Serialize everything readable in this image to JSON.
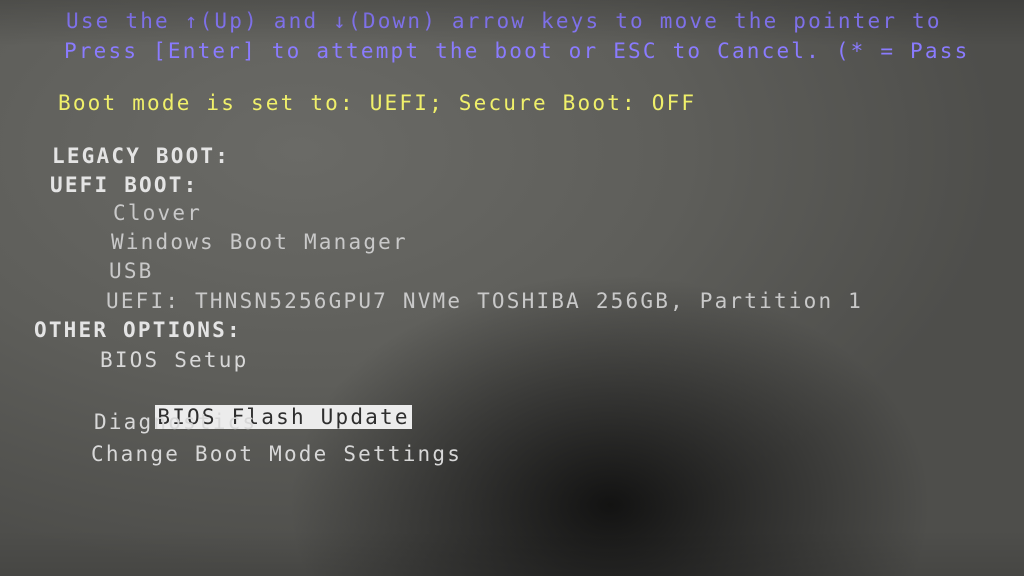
{
  "instructions": {
    "line1": "Use the ↑(Up) and ↓(Down) arrow keys to move the pointer to",
    "line2": "Press [Enter] to attempt the boot or ESC to Cancel. (* = Pass"
  },
  "boot_mode": "Boot mode is set to: UEFI; Secure Boot: OFF",
  "sections": {
    "legacy": "LEGACY BOOT:",
    "uefi": "UEFI BOOT:",
    "other": "OTHER OPTIONS:"
  },
  "uefi_items": [
    "Clover",
    "Windows Boot Manager",
    "USB",
    "UEFI: THNSN5256GPU7 NVMe TOSHIBA 256GB, Partition 1"
  ],
  "other_items": [
    "BIOS Setup",
    "BIOS Flash Update",
    "Diagnostics",
    "Change Boot Mode Settings"
  ],
  "selected_item": "BIOS Flash Update",
  "colors": {
    "instructions": "#8a7bff",
    "boot_mode": "#f0f06a",
    "highlight": "#ececec"
  }
}
